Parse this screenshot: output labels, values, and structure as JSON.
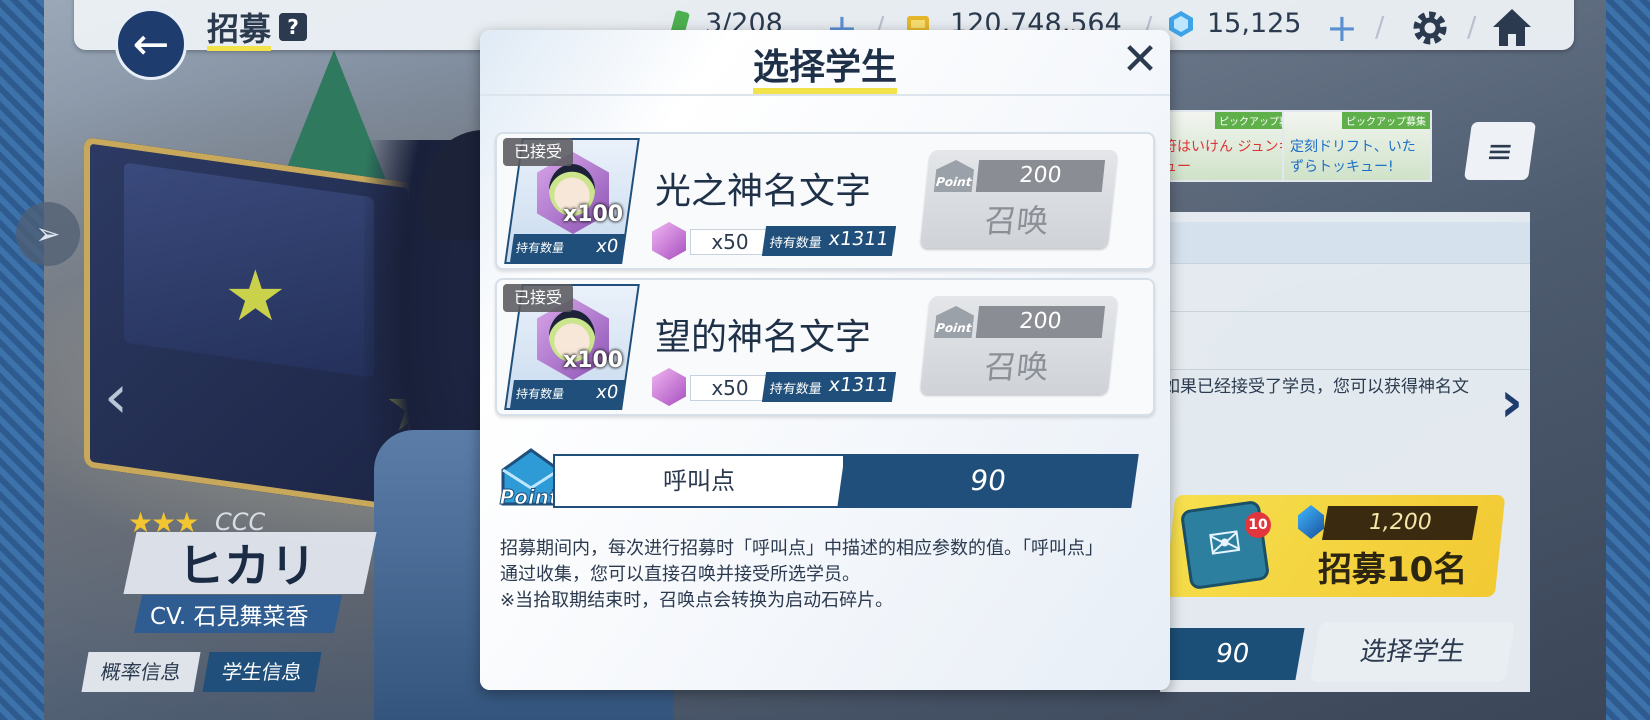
{
  "header": {
    "title": "招募",
    "help": "?",
    "ap": "3/208",
    "credits": "120,748,564",
    "gems": "15,125"
  },
  "character": {
    "stars": "★★★",
    "rarity": "CCC",
    "name": "ヒカリ",
    "cv": "CV. 石見舞菜香"
  },
  "bottom_tabs": {
    "probability": "概率信息",
    "student_info": "学生信息"
  },
  "right_panel": {
    "desc": "如果已经接受了学员，您可以获得神名文",
    "recruit_cost": "1,200",
    "recruit_label": "招募10名",
    "mail_badge": "10",
    "points": "90",
    "select_student": "选择学生"
  },
  "banners": {
    "banner1": "ピックアップ募集",
    "banner1_text": "符はいけん ジュンキュー",
    "banner2": "ピックアップ募集",
    "banner2_text": "定刻ドリフト、いたずらトッキュー!"
  },
  "modal": {
    "title": "选择学生",
    "cards": [
      {
        "status": "已接受",
        "multiplier": "x100",
        "owned_label": "持有数量",
        "owned_value": "x0",
        "name": "光之神名文字",
        "cost_amount": "x50",
        "cost_owned_label": "持有数量",
        "cost_owned_value": "x1311",
        "summon_price": "200",
        "summon_point_tag": "Point",
        "summon_label": "召唤"
      },
      {
        "status": "已接受",
        "multiplier": "x100",
        "owned_label": "持有数量",
        "owned_value": "x0",
        "name": "望的神名文字",
        "cost_amount": "x50",
        "cost_owned_label": "持有数量",
        "cost_owned_value": "x1311",
        "summon_price": "200",
        "summon_point_tag": "Point",
        "summon_label": "召唤"
      }
    ],
    "point_icon_label": "Point",
    "point_label": "呼叫点",
    "point_value": "90",
    "description": [
      "招募期间内，每次进行招募时「呼叫点」中描述的相应参数的值。「呼叫点」",
      "通过收集，您可以直接召唤并接受所选学员。",
      "※当拾取期结束时，召唤点会转换为启动石碎片。"
    ]
  },
  "colors": {
    "navy": "#1f4f7a",
    "accent_yellow": "#f3e34a",
    "gold_button": "#f2c933",
    "text_dark": "#2b3a4f"
  }
}
